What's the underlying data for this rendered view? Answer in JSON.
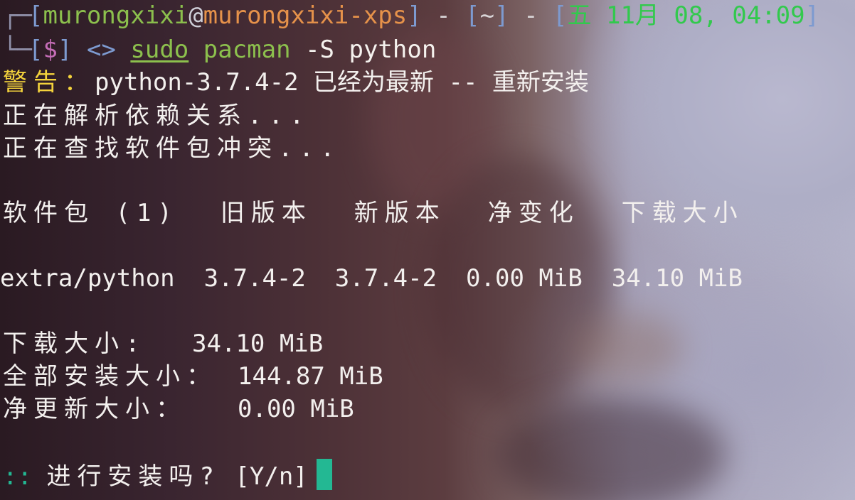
{
  "prompt": {
    "bracket_open": "[",
    "user": "murongxixi",
    "at": "@",
    "host": "murongxixi-xps",
    "bracket_close": "]",
    "sep1": " - ",
    "dir_open": "[",
    "dir": "~",
    "dir_close": "]",
    "sep2": " - ",
    "date_open": "[",
    "date": "五 11月 08, 04:09",
    "date_close": "]",
    "dollar_open": "[",
    "dollar": "$",
    "dollar_close": "]",
    "arrows": "<>",
    "sudo": "sudo",
    "command": "pacman",
    "args": "-S python"
  },
  "output": {
    "warning_label": "警告：",
    "warning_text": "python-3.7.4-2 已经为最新 -- 重新安装",
    "resolving": "正在解析依赖关系...",
    "checking": "正在查找软件包冲突...",
    "table_header": "软件包 (1)  旧版本  新版本  净变化  下载大小",
    "package_row": "extra/python  3.7.4-2  3.7.4-2  0.00 MiB  34.10 MiB",
    "summary": [
      {
        "label": "下载大小:",
        "value": "34.10 MiB"
      },
      {
        "label": "全部安装大小：",
        "value": "144.87 MiB"
      },
      {
        "label": "净更新大小：",
        "value": "0.00 MiB"
      }
    ],
    "confirm_prefix": "::",
    "confirm_question": "进行安装吗?",
    "confirm_options": "[Y/n]"
  },
  "colors": {
    "user": "#8cc04d",
    "host": "#e6924a",
    "date": "#32c94d",
    "bracket": "#7d9ad0",
    "warning": "#f3d23c",
    "cursor": "#23b893"
  }
}
